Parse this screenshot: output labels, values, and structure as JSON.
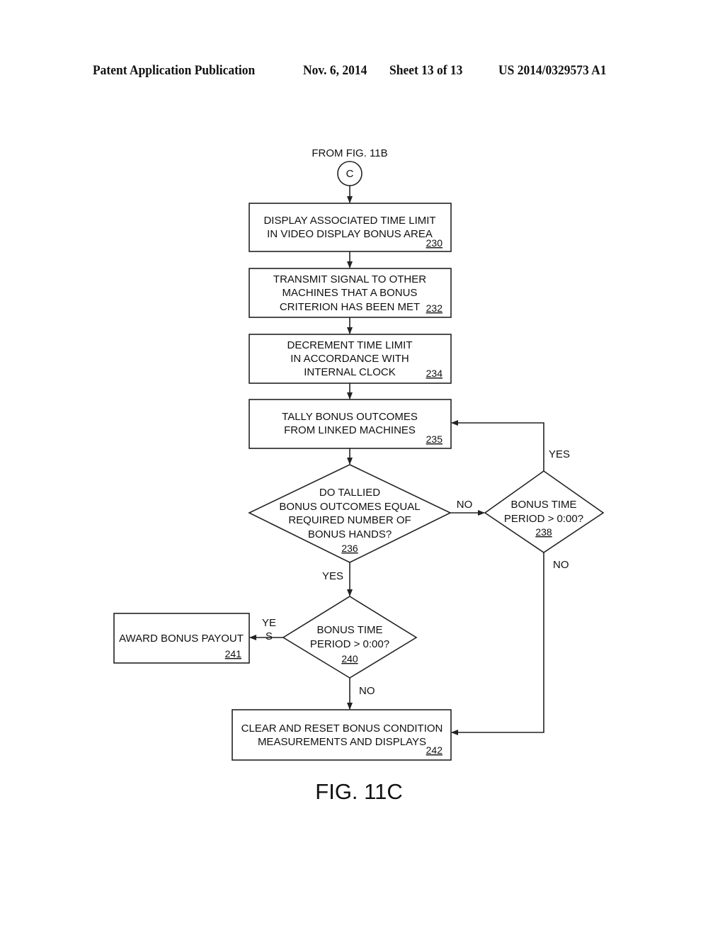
{
  "header": {
    "left": "Patent Application Publication",
    "date": "Nov. 6, 2014",
    "sheet": "Sheet 13 of 13",
    "number": "US 2014/0329573 A1"
  },
  "connector": {
    "caption": "FROM FIG. 11B",
    "label": "C"
  },
  "nodes": {
    "n230": {
      "lines": [
        "DISPLAY ASSOCIATED TIME LIMIT",
        "IN VIDEO DISPLAY BONUS AREA"
      ],
      "ref": "230"
    },
    "n232": {
      "lines": [
        "TRANSMIT SIGNAL TO OTHER",
        "MACHINES THAT A BONUS",
        "CRITERION HAS BEEN MET"
      ],
      "ref": "232"
    },
    "n234": {
      "lines": [
        "DECREMENT TIME LIMIT",
        "IN ACCORDANCE WITH",
        "INTERNAL CLOCK"
      ],
      "ref": "234"
    },
    "n235": {
      "lines": [
        "TALLY BONUS OUTCOMES",
        "FROM LINKED MACHINES"
      ],
      "ref": "235"
    },
    "n236": {
      "lines": [
        "DO TALLIED",
        "BONUS OUTCOMES EQUAL",
        "REQUIRED NUMBER OF",
        "BONUS HANDS?"
      ],
      "ref": "236"
    },
    "n238": {
      "lines": [
        "BONUS TIME",
        "PERIOD > 0:00?"
      ],
      "ref": "238"
    },
    "n240": {
      "lines": [
        "BONUS TIME",
        "PERIOD > 0:00?"
      ],
      "ref": "240"
    },
    "n241": {
      "lines": [
        "AWARD BONUS PAYOUT"
      ],
      "ref": "241"
    },
    "n242": {
      "lines": [
        "CLEAR AND RESET BONUS CONDITION",
        "MEASUREMENTS AND DISPLAYS"
      ],
      "ref": "242"
    }
  },
  "edge_labels": {
    "no_236": "NO",
    "yes_236": "YES",
    "yes_238": "YES",
    "no_238": "NO",
    "yes_240_a": "YE",
    "yes_240_b": "S",
    "no_240": "NO"
  },
  "figure_label": "FIG. 11C"
}
